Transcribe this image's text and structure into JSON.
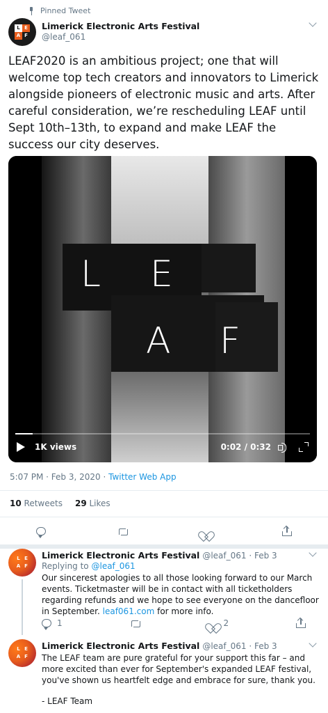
{
  "pinned_label": "Pinned Tweet",
  "tweet": {
    "author_name": "Limerick Electronic Arts Festival",
    "author_handle": "@leaf_061",
    "text": "LEAF2020 is an ambitious project; one that will welcome top tech creators and innovators to Limerick alongside pioneers of electronic music and arts. After careful consideration, we’re rescheduling LEAF until Sept 10th–13th, to expand and make LEAF the success our city deserves.",
    "video": {
      "letters": [
        "L",
        "E",
        "A",
        "F"
      ],
      "views": "1K views",
      "time": "0:02 / 0:32",
      "progress_fraction": 0.06
    },
    "timestamp": "5:07 PM · Feb 3, 2020 ·",
    "client": "Twitter Web App",
    "retweets_count": "10",
    "retweets_label": "Retweets",
    "likes_count": "29",
    "likes_label": "Likes"
  },
  "replies": [
    {
      "author_name": "Limerick Electronic Arts Festival",
      "author_handle": "@leaf_061 · Feb 3",
      "replying_prefix": "Replying to",
      "replying_to": "@leaf_061",
      "text_before_link": "Our sincerest apologies to all those looking forward to our March events. Ticketmaster will be in contact with all ticketholders regarding refunds and we hope to see everyone on the dancefloor in September.",
      "link": "leaf061.com",
      "text_after_link": "for more info.",
      "reply_count": "1",
      "like_count": "2"
    },
    {
      "author_name": "Limerick Electronic Arts Festival",
      "author_handle": "@leaf_061 · Feb 3",
      "text": "The LEAF team are pure grateful for your support this far – and more excited than ever for September's expanded LEAF festival, you've shown us heartfelt edge and embrace for sure, thank you.",
      "signoff": "- LEAF Team"
    }
  ],
  "colors": {
    "accent": "#1b95e0",
    "secondary_text": "#657786",
    "divider": "#e6ecf0",
    "avatar_orange": "#e85d1c"
  },
  "icons": [
    "pin-icon",
    "chevron-down-icon",
    "play-icon",
    "volume-icon",
    "fullscreen-icon",
    "reply-icon",
    "retweet-icon",
    "like-icon",
    "share-icon"
  ]
}
